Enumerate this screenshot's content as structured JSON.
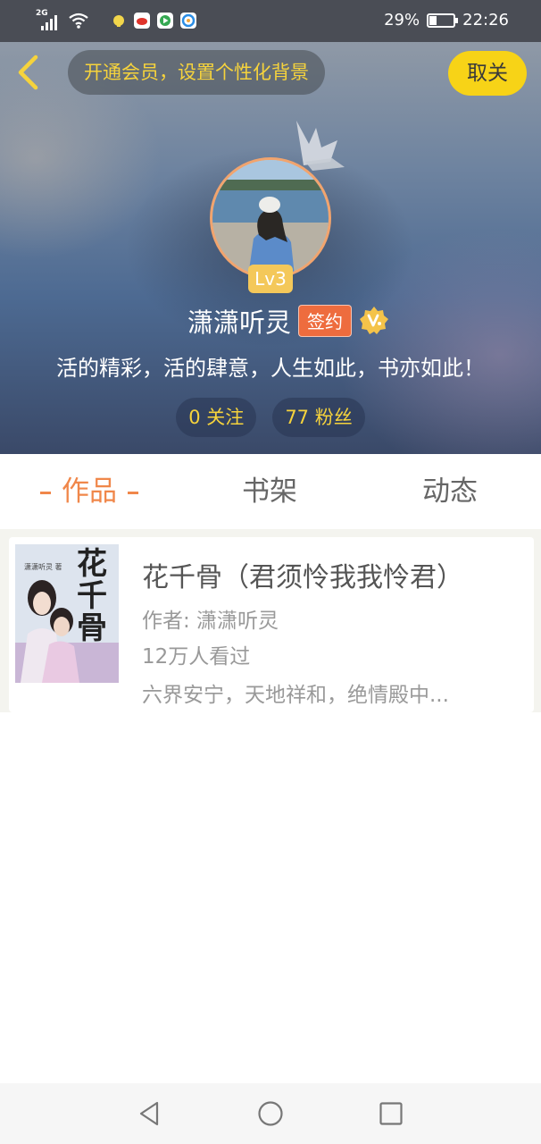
{
  "status_bar": {
    "network": "2G",
    "battery_percent": "29%",
    "battery_level": 0.29,
    "time": "22:26",
    "icons": [
      "signal-icon",
      "wifi-icon",
      "notification-app-icon",
      "weibo-app-icon",
      "video-app-icon",
      "browser-app-icon",
      "battery-icon"
    ]
  },
  "header": {
    "vip_prompt": "开通会员，设置个性化背景",
    "cancel_label": "取关",
    "level": "Lv3",
    "user_name": "潇潇听灵",
    "sign_badge": "签约",
    "bio": "活的精彩，活的肆意，人生如此，书亦如此！",
    "following": "0 关注",
    "followers": "77 粉丝"
  },
  "tabs": [
    {
      "label": "作品",
      "active": true
    },
    {
      "label": "书架",
      "active": false
    },
    {
      "label": "动态",
      "active": false
    }
  ],
  "books": [
    {
      "title": "花千骨（君须怜我我怜君）",
      "author": "作者: 潇潇听灵",
      "views": "12万人看过",
      "description": "六界安宁，天地祥和，绝情殿中...",
      "cover_title": "花千骨",
      "cover_author": "潇潇听灵 著"
    }
  ],
  "colors": {
    "accent": "#f0874a",
    "vip_yellow": "#f6d33c",
    "cancel_yellow": "#f7d317",
    "sign_badge": "#ee6c3e"
  }
}
